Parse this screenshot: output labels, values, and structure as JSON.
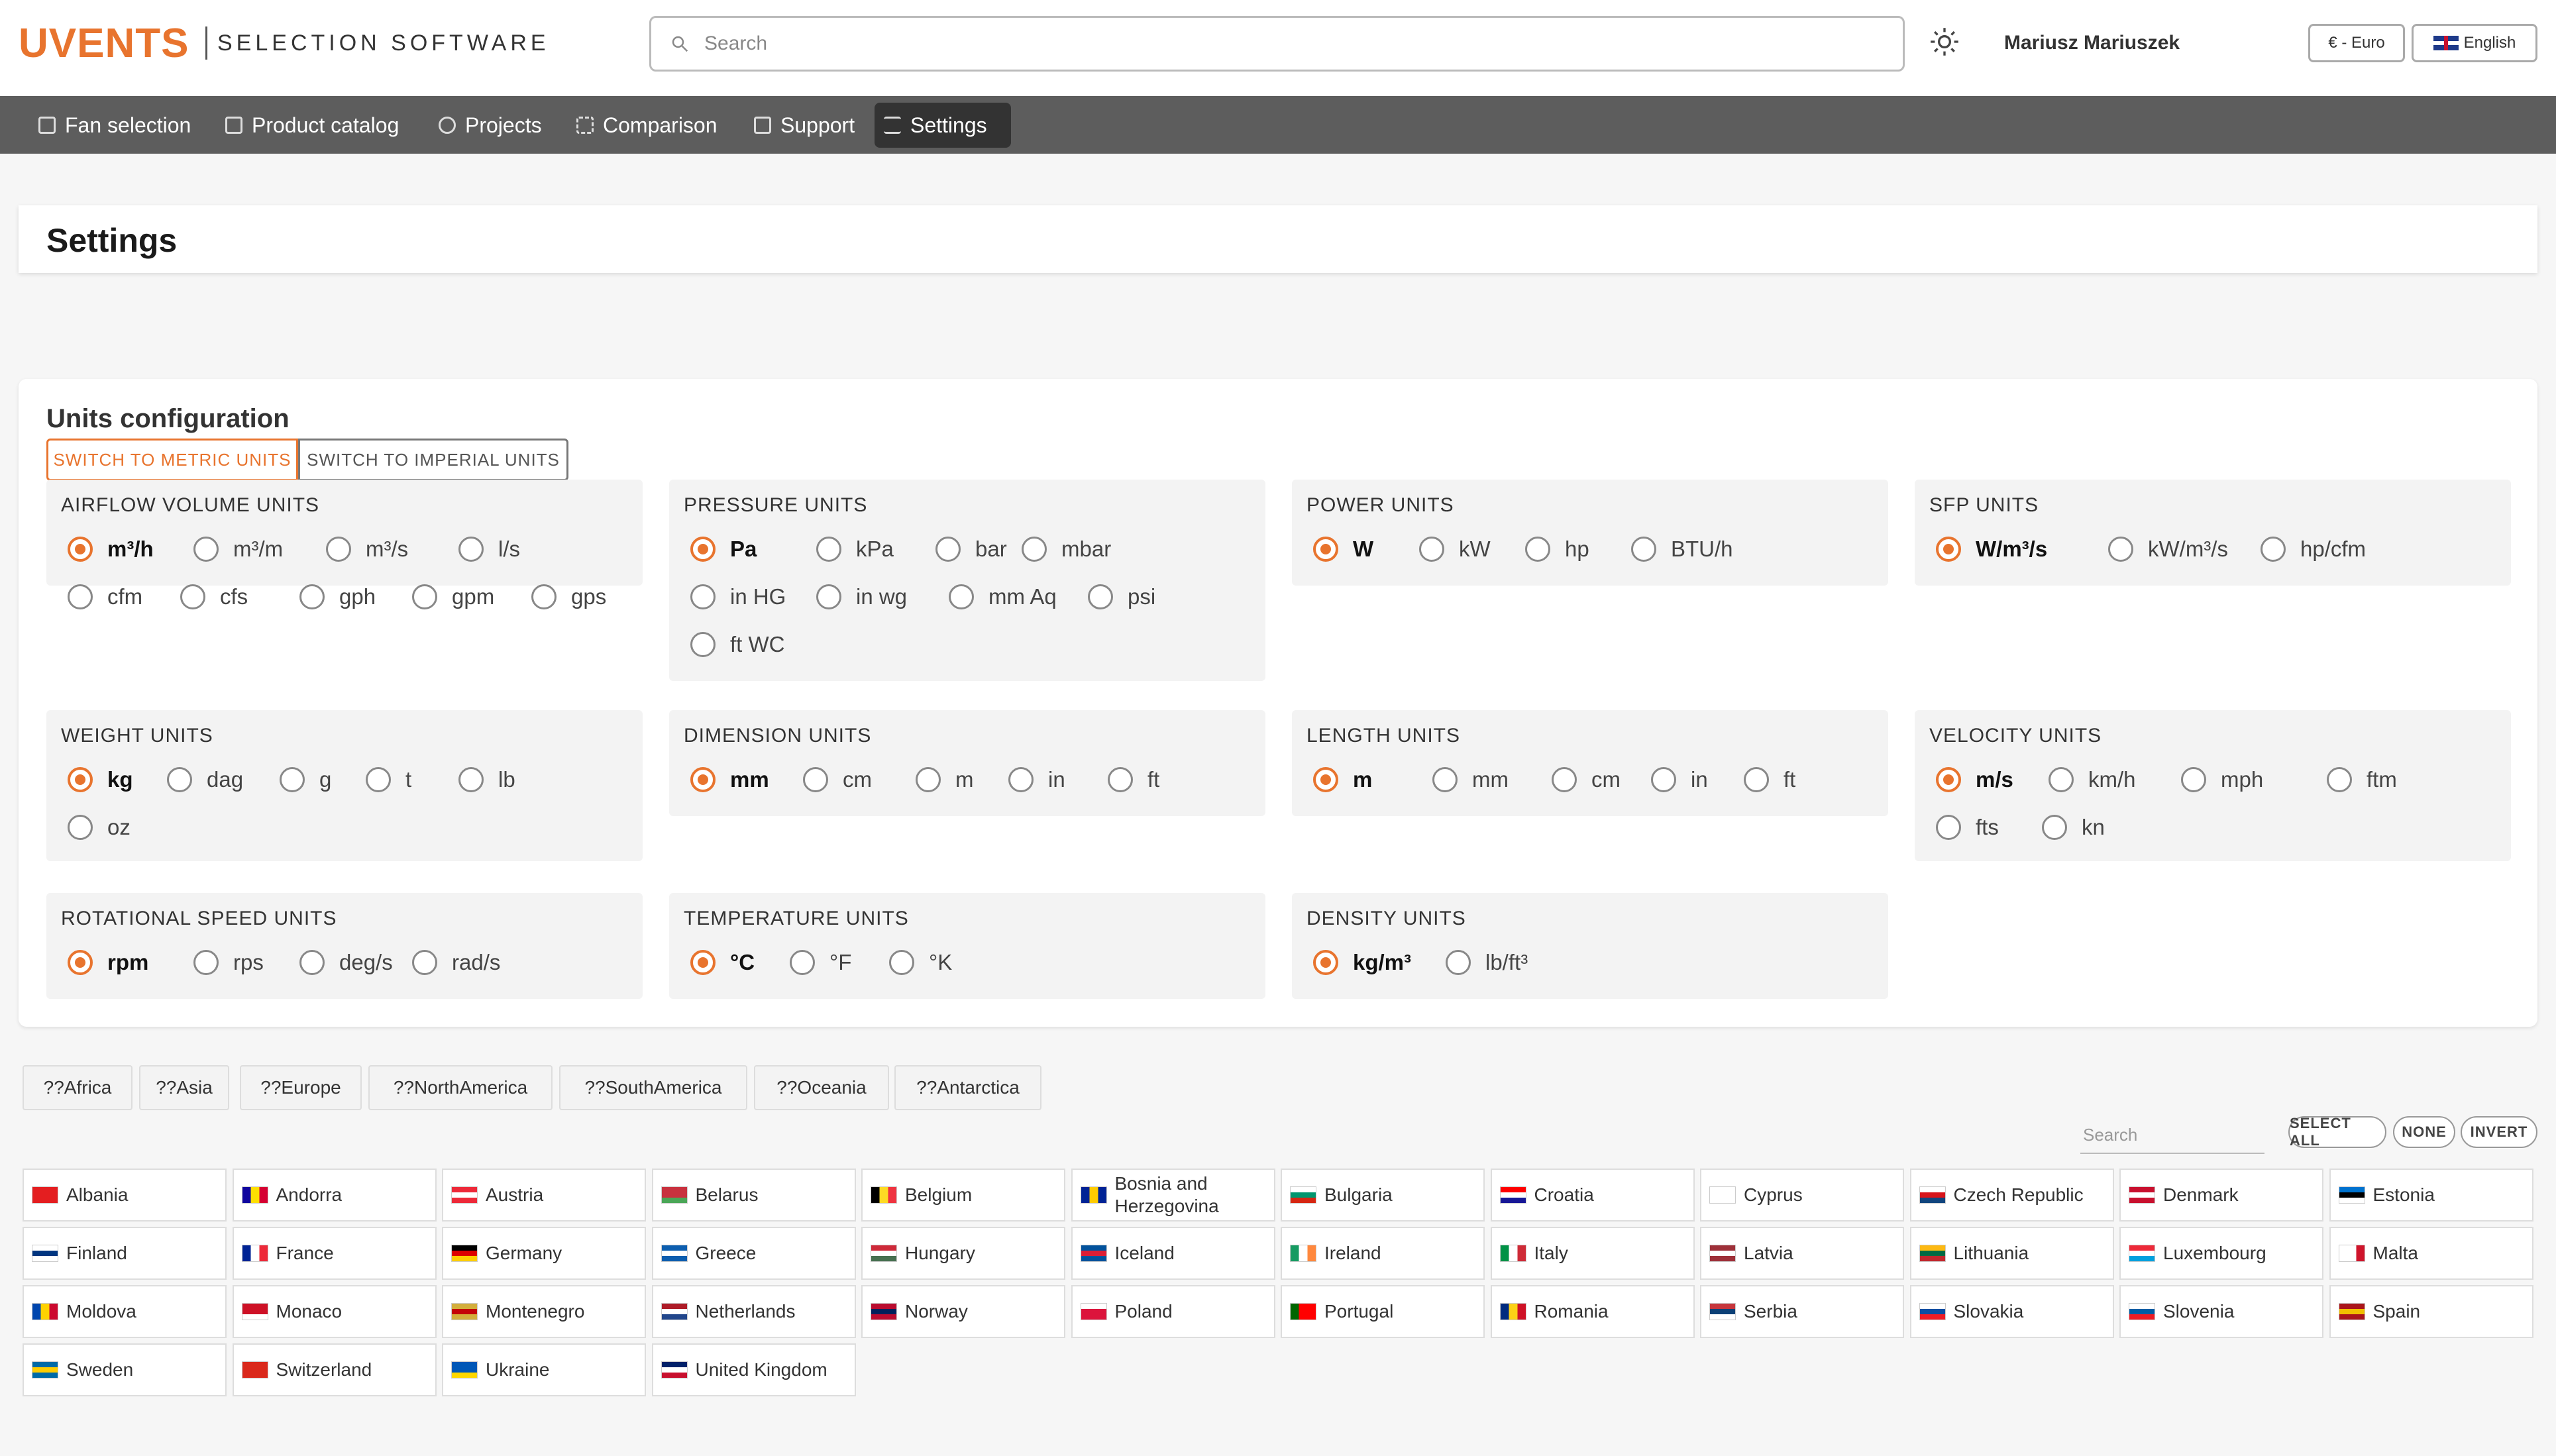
{
  "header": {
    "logo": "UVENTS",
    "logo_sub": "SELECTION SOFTWARE",
    "search_placeholder": "Search",
    "user": "Mariusz Mariuszek",
    "currency": "€ - Euro",
    "language": "English"
  },
  "nav": [
    {
      "label": "Fan selection",
      "icon": "calculator-icon"
    },
    {
      "label": "Product catalog",
      "icon": "catalog-icon"
    },
    {
      "label": "Projects",
      "icon": "compass-icon"
    },
    {
      "label": "Comparison",
      "icon": "compare-icon"
    },
    {
      "label": "Support",
      "icon": "help-icon"
    },
    {
      "label": "Settings",
      "icon": "sliders-icon",
      "active": true
    }
  ],
  "page_title": "Settings",
  "units": {
    "title": "Units configuration",
    "switch_metric": "SWITCH TO METRIC UNITS",
    "switch_imperial": "SWITCH TO IMPERIAL UNITS",
    "groups": [
      {
        "title": "AIRFLOW VOLUME UNITS",
        "options": [
          "m³/h",
          "m³/m",
          "m³/s",
          "l/s",
          "cfm",
          "cfs",
          "gph",
          "gpm",
          "gps"
        ],
        "selected": "m³/h"
      },
      {
        "title": "PRESSURE UNITS",
        "options": [
          "Pa",
          "kPa",
          "bar",
          "mbar",
          "in HG",
          "in wg",
          "mm Aq",
          "psi",
          "ft WC"
        ],
        "selected": "Pa"
      },
      {
        "title": "POWER UNITS",
        "options": [
          "W",
          "kW",
          "hp",
          "BTU/h"
        ],
        "selected": "W"
      },
      {
        "title": "SFP UNITS",
        "options": [
          "W/m³/s",
          "kW/m³/s",
          "hp/cfm"
        ],
        "selected": "W/m³/s"
      },
      {
        "title": "WEIGHT UNITS",
        "options": [
          "kg",
          "dag",
          "g",
          "t",
          "lb",
          "oz"
        ],
        "selected": "kg"
      },
      {
        "title": "DIMENSION UNITS",
        "options": [
          "mm",
          "cm",
          "m",
          "in",
          "ft"
        ],
        "selected": "mm"
      },
      {
        "title": "LENGTH UNITS",
        "options": [
          "m",
          "mm",
          "cm",
          "in",
          "ft"
        ],
        "selected": "m"
      },
      {
        "title": "VELOCITY UNITS",
        "options": [
          "m/s",
          "km/h",
          "mph",
          "ftm",
          "fts",
          "kn"
        ],
        "selected": "m/s"
      },
      {
        "title": "ROTATIONAL SPEED UNITS",
        "options": [
          "rpm",
          "rps",
          "deg/s",
          "rad/s"
        ],
        "selected": "rpm"
      },
      {
        "title": "TEMPERATURE UNITS",
        "options": [
          "°C",
          "°F",
          "°K"
        ],
        "selected": "°C"
      },
      {
        "title": "DENSITY UNITS",
        "options": [
          "kg/m³",
          "lb/ft³"
        ],
        "selected": "kg/m³"
      }
    ]
  },
  "continents": [
    "??Africa",
    "??Asia",
    "??Europe",
    "??NorthAmerica",
    "??SouthAmerica",
    "??Oceania",
    "??Antarctica"
  ],
  "country_search_placeholder": "Search",
  "country_actions": [
    "SELECT ALL",
    "NONE",
    "INVERT"
  ],
  "countries": [
    {
      "name": "Albania",
      "flag": [
        "#e41e20",
        "#e41e20",
        "#e41e20"
      ],
      "mode": "h"
    },
    {
      "name": "Andorra",
      "flag": [
        "#10069f",
        "#fedf00",
        "#d50032"
      ],
      "mode": "v"
    },
    {
      "name": "Austria",
      "flag": [
        "#ed2939",
        "#ffffff",
        "#ed2939"
      ],
      "mode": "h"
    },
    {
      "name": "Belarus",
      "flag": [
        "#c8313e",
        "#c8313e",
        "#4aa657"
      ],
      "mode": "h"
    },
    {
      "name": "Belgium",
      "flag": [
        "#000000",
        "#fdda24",
        "#ef3340"
      ],
      "mode": "v"
    },
    {
      "name": "Bosnia and Herzegovina",
      "flag": [
        "#002395",
        "#fecb00",
        "#002395"
      ],
      "mode": "v"
    },
    {
      "name": "Bulgaria",
      "flag": [
        "#ffffff",
        "#00966e",
        "#d62612"
      ],
      "mode": "h"
    },
    {
      "name": "Croatia",
      "flag": [
        "#ff0000",
        "#ffffff",
        "#171796"
      ],
      "mode": "h"
    },
    {
      "name": "Cyprus",
      "flag": [
        "#ffffff",
        "#ffffff",
        "#ffffff"
      ],
      "mode": "h"
    },
    {
      "name": "Czech Republic",
      "flag": [
        "#ffffff",
        "#d7141a",
        "#11457e"
      ],
      "mode": "h"
    },
    {
      "name": "Denmark",
      "flag": [
        "#c8102e",
        "#ffffff",
        "#c8102e"
      ],
      "mode": "h"
    },
    {
      "name": "Estonia",
      "flag": [
        "#0072ce",
        "#000000",
        "#ffffff"
      ],
      "mode": "h"
    },
    {
      "name": "Finland",
      "flag": [
        "#ffffff",
        "#003580",
        "#ffffff"
      ],
      "mode": "h"
    },
    {
      "name": "France",
      "flag": [
        "#002395",
        "#ffffff",
        "#ed2939"
      ],
      "mode": "v"
    },
    {
      "name": "Germany",
      "flag": [
        "#000000",
        "#dd0000",
        "#ffce00"
      ],
      "mode": "h"
    },
    {
      "name": "Greece",
      "flag": [
        "#0d5eaf",
        "#ffffff",
        "#0d5eaf"
      ],
      "mode": "h"
    },
    {
      "name": "Hungary",
      "flag": [
        "#ce2939",
        "#ffffff",
        "#477050"
      ],
      "mode": "h"
    },
    {
      "name": "Iceland",
      "flag": [
        "#02529c",
        "#dc1e35",
        "#02529c"
      ],
      "mode": "h"
    },
    {
      "name": "Ireland",
      "flag": [
        "#169b62",
        "#ffffff",
        "#ff883e"
      ],
      "mode": "v"
    },
    {
      "name": "Italy",
      "flag": [
        "#009246",
        "#ffffff",
        "#ce2b37"
      ],
      "mode": "v"
    },
    {
      "name": "Latvia",
      "flag": [
        "#9e3039",
        "#ffffff",
        "#9e3039"
      ],
      "mode": "h"
    },
    {
      "name": "Lithuania",
      "flag": [
        "#fdb913",
        "#006a44",
        "#c1272d"
      ],
      "mode": "h"
    },
    {
      "name": "Luxembourg",
      "flag": [
        "#ed2939",
        "#ffffff",
        "#00a1de"
      ],
      "mode": "h"
    },
    {
      "name": "Malta",
      "flag": [
        "#ffffff",
        "#ffffff",
        "#cf142b"
      ],
      "mode": "v"
    },
    {
      "name": "Moldova",
      "flag": [
        "#0046ae",
        "#ffd200",
        "#cc092f"
      ],
      "mode": "v"
    },
    {
      "name": "Monaco",
      "flag": [
        "#ce1126",
        "#ce1126",
        "#ffffff"
      ],
      "mode": "h"
    },
    {
      "name": "Montenegro",
      "flag": [
        "#d3ae3b",
        "#c40308",
        "#d3ae3b"
      ],
      "mode": "h"
    },
    {
      "name": "Netherlands",
      "flag": [
        "#ae1c28",
        "#ffffff",
        "#21468b"
      ],
      "mode": "h"
    },
    {
      "name": "Norway",
      "flag": [
        "#ba0c2f",
        "#00205b",
        "#ba0c2f"
      ],
      "mode": "h"
    },
    {
      "name": "Poland",
      "flag": [
        "#ffffff",
        "#dc143c",
        "#dc143c"
      ],
      "mode": "h"
    },
    {
      "name": "Portugal",
      "flag": [
        "#006600",
        "#ff0000",
        "#ff0000"
      ],
      "mode": "v"
    },
    {
      "name": "Romania",
      "flag": [
        "#002b7f",
        "#fcd116",
        "#ce1126"
      ],
      "mode": "v"
    },
    {
      "name": "Serbia",
      "flag": [
        "#c6363c",
        "#0c4076",
        "#ffffff"
      ],
      "mode": "h"
    },
    {
      "name": "Slovakia",
      "flag": [
        "#ffffff",
        "#0b4ea2",
        "#ee1c25"
      ],
      "mode": "h"
    },
    {
      "name": "Slovenia",
      "flag": [
        "#ffffff",
        "#005da4",
        "#ed1c24"
      ],
      "mode": "h"
    },
    {
      "name": "Spain",
      "flag": [
        "#aa151b",
        "#f1bf00",
        "#aa151b"
      ],
      "mode": "h"
    },
    {
      "name": "Sweden",
      "flag": [
        "#006aa7",
        "#fecc00",
        "#006aa7"
      ],
      "mode": "h"
    },
    {
      "name": "Switzerland",
      "flag": [
        "#da291c",
        "#da291c",
        "#da291c"
      ],
      "mode": "h"
    },
    {
      "name": "Ukraine",
      "flag": [
        "#0057b7",
        "#0057b7",
        "#ffd700"
      ],
      "mode": "h"
    },
    {
      "name": "United Kingdom",
      "flag": [
        "#012169",
        "#ffffff",
        "#c8102e"
      ],
      "mode": "h"
    }
  ],
  "colors": {
    "accent": "#e8742e",
    "nav_bg": "#5d5d5d",
    "nav_active": "#333333"
  }
}
